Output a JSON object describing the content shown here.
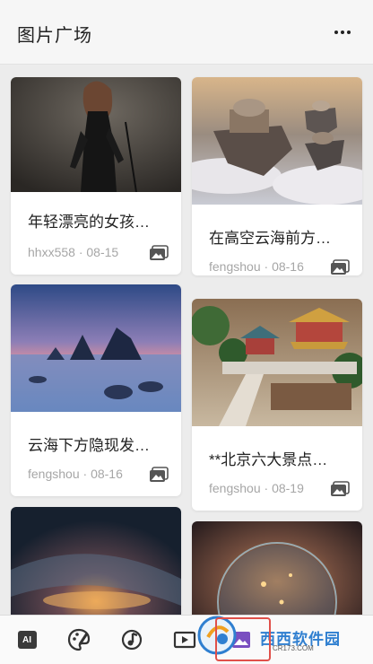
{
  "header": {
    "title": "图片广场",
    "more_icon": "more-dots-icon"
  },
  "cards": [
    {
      "title": "年轻漂亮的女孩…",
      "author": "hhxx558",
      "date": "08-15"
    },
    {
      "title": "在高空云海前方…",
      "author": "fengshou",
      "date": "08-16"
    },
    {
      "title": "云海下方隐现发…",
      "author": "fengshou",
      "date": "08-16"
    },
    {
      "title": "**北京六大景点…",
      "author": "fengshou",
      "date": "08-19"
    }
  ],
  "separator": "·",
  "nav": {
    "ai_label": "AI",
    "items": [
      "ai-icon",
      "palette-icon",
      "music-note-icon",
      "video-icon",
      "image-icon"
    ]
  },
  "watermark": {
    "brand": "西西软件园",
    "site": "CR173.COM"
  },
  "colors": {
    "highlight": "#e0504a",
    "watermark": "#2f7fd0"
  }
}
